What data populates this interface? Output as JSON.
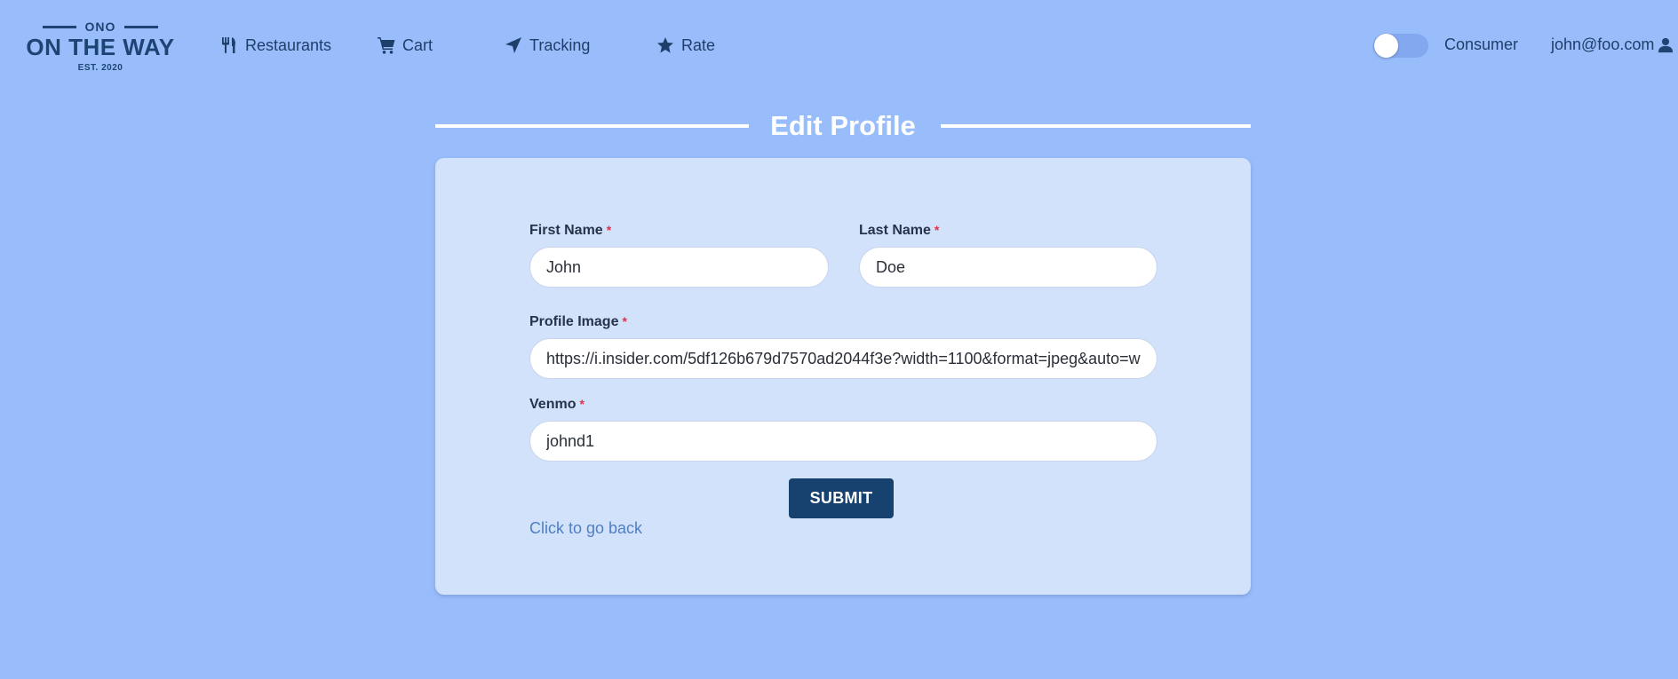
{
  "logo": {
    "top": "ONO",
    "main": "ON THE WAY",
    "est": "EST. 2020"
  },
  "nav": {
    "restaurants": {
      "label": "Restaurants",
      "icon": "utensils-icon"
    },
    "cart": {
      "label": "Cart",
      "icon": "cart-icon"
    },
    "tracking": {
      "label": "Tracking",
      "icon": "location-arrow-icon"
    },
    "rate": {
      "label": "Rate",
      "icon": "star-icon"
    }
  },
  "header_right": {
    "toggle_on": false,
    "role_label": "Consumer",
    "user_email": "john@foo.com",
    "user_icon": "user-icon"
  },
  "page": {
    "title": "Edit Profile"
  },
  "form": {
    "first_name": {
      "label": "First Name",
      "required_mark": "*",
      "value": "John"
    },
    "last_name": {
      "label": "Last Name",
      "required_mark": "*",
      "value": "Doe"
    },
    "profile_image": {
      "label": "Profile Image",
      "required_mark": "*",
      "value": "https://i.insider.com/5df126b679d7570ad2044f3e?width=1100&format=jpeg&auto=w"
    },
    "venmo": {
      "label": "Venmo",
      "required_mark": "*",
      "value": "johnd1"
    },
    "submit_label": "SUBMIT",
    "back_link": "Click to go back"
  },
  "colors": {
    "background": "#99bdfb",
    "card": "#d3e2fb",
    "brand_dark": "#17416f",
    "required": "#e0314b",
    "link": "#4f7fc0"
  }
}
